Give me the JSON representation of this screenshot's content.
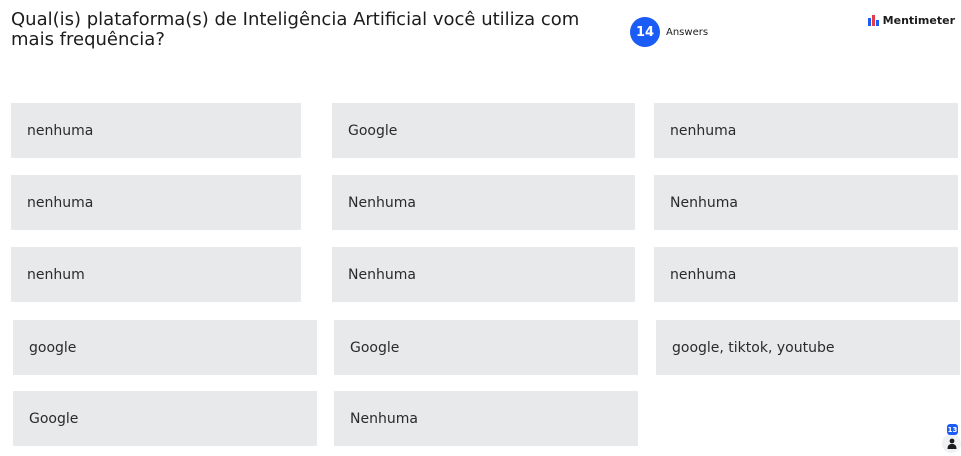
{
  "question": {
    "title": "Qual(is) plataforma(s) de Inteligência Artificial você utiliza com mais frequência?"
  },
  "answers": {
    "count": "14",
    "label": "Answers"
  },
  "brand": {
    "name": "Mentimeter",
    "logo_icon": "mentimeter-logo"
  },
  "responses": [
    "nenhuma",
    "Google",
    "nenhuma",
    "nenhuma",
    "Nenhuma",
    "Nenhuma",
    "nenhum",
    "Nenhuma",
    "nenhuma",
    "google",
    "Google",
    "google, tiktok, youtube",
    "Google",
    "Nenhuma"
  ],
  "participants": {
    "count": "13",
    "icon": "person-icon"
  },
  "colors": {
    "accent": "#1a5cf5",
    "card_bg": "#e8e9eb"
  }
}
